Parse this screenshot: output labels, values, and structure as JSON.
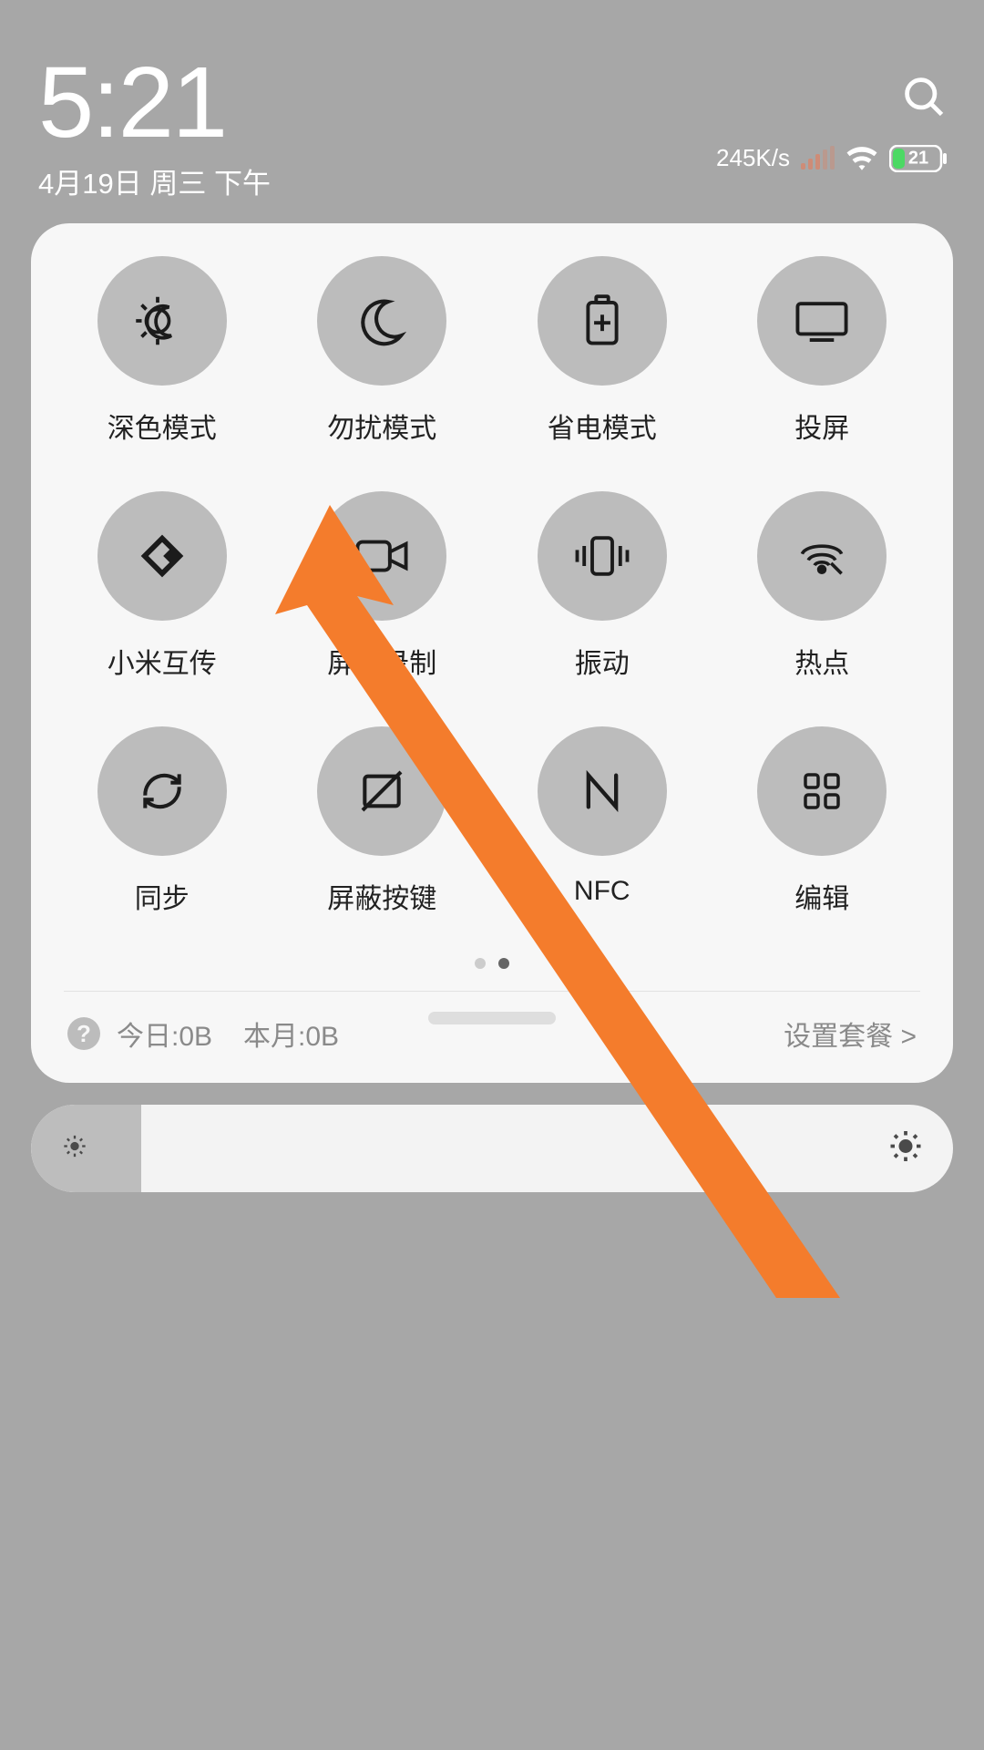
{
  "header": {
    "time": "5:21",
    "date": "4月19日 周三 下午"
  },
  "status": {
    "speed": "245K/s",
    "battery_percent": "21"
  },
  "tiles": [
    {
      "id": "dark-mode",
      "label": "深色模式"
    },
    {
      "id": "dnd",
      "label": "勿扰模式"
    },
    {
      "id": "battery-saver",
      "label": "省电模式"
    },
    {
      "id": "cast",
      "label": "投屏"
    },
    {
      "id": "mi-share",
      "label": "小米互传"
    },
    {
      "id": "screen-record",
      "label": "屏幕录制"
    },
    {
      "id": "vibrate",
      "label": "振动"
    },
    {
      "id": "hotspot",
      "label": "热点"
    },
    {
      "id": "sync",
      "label": "同步"
    },
    {
      "id": "hide-keys",
      "label": "屏蔽按键"
    },
    {
      "id": "nfc",
      "label": "NFC"
    },
    {
      "id": "edit",
      "label": "编辑"
    }
  ],
  "data_usage": {
    "today": "今日:0B",
    "month": "本月:0B",
    "set_plan": "设置套餐 >"
  }
}
